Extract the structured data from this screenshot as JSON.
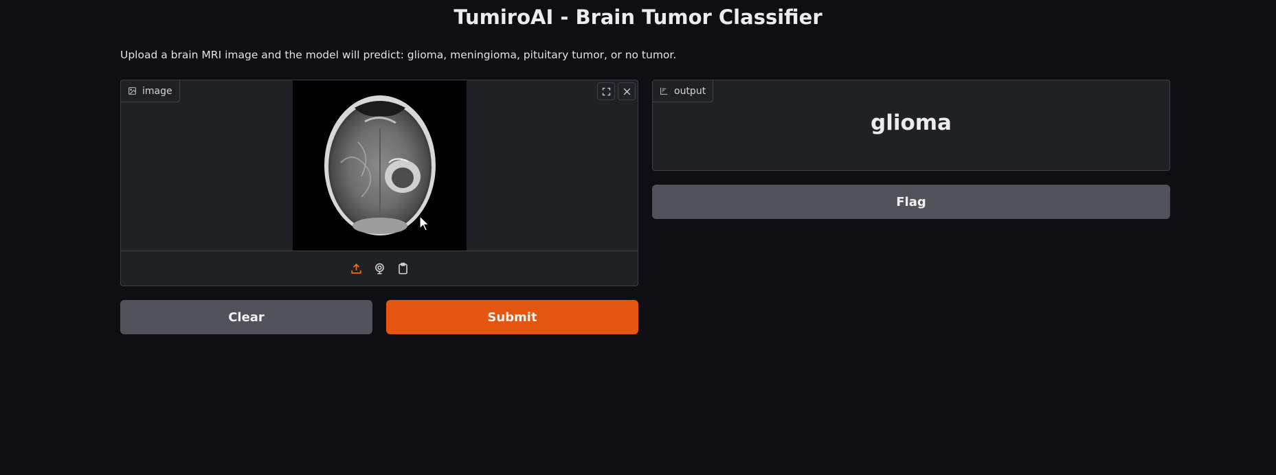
{
  "app": {
    "title": "TumiroAI - Brain Tumor Classifier",
    "description": "Upload a brain MRI image and the model will predict: glioma, meningioma, pituitary tumor, or no tumor."
  },
  "input": {
    "label": "image",
    "label_icon": "image-icon",
    "tools": [
      "fullscreen-icon",
      "close-icon"
    ],
    "sources": [
      "upload-icon",
      "webcam-icon",
      "clipboard-icon"
    ]
  },
  "output": {
    "label": "output",
    "label_icon": "chart-icon",
    "prediction": "glioma"
  },
  "buttons": {
    "clear": "Clear",
    "submit": "Submit",
    "flag": "Flag"
  },
  "colors": {
    "background": "#0f0f13",
    "panel": "#1f2124",
    "border": "#3d3f46",
    "primary": "#e4560f",
    "secondary": "#52525b"
  }
}
